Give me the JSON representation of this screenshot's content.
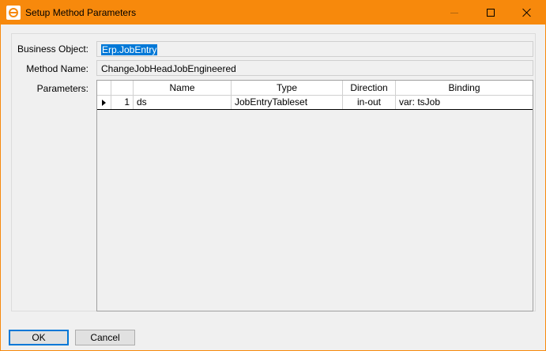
{
  "window": {
    "title": "Setup Method Parameters",
    "accent_color": "#f7890c",
    "icon": "epicor-e-icon"
  },
  "form": {
    "business_object_label": "Business Object:",
    "business_object_value": "Erp.JobEntry",
    "method_name_label": "Method Name:",
    "method_name_value": "ChangeJobHeadJobEngineered",
    "parameters_label": "Parameters:"
  },
  "grid": {
    "columns": [
      "",
      "",
      "Name",
      "Type",
      "Direction",
      "Binding"
    ],
    "rows": [
      {
        "num": "1",
        "name": "ds",
        "type": "JobEntryTableset",
        "direction": "in-out",
        "binding": "var: tsJob"
      }
    ]
  },
  "buttons": {
    "ok": "OK",
    "cancel": "Cancel"
  }
}
